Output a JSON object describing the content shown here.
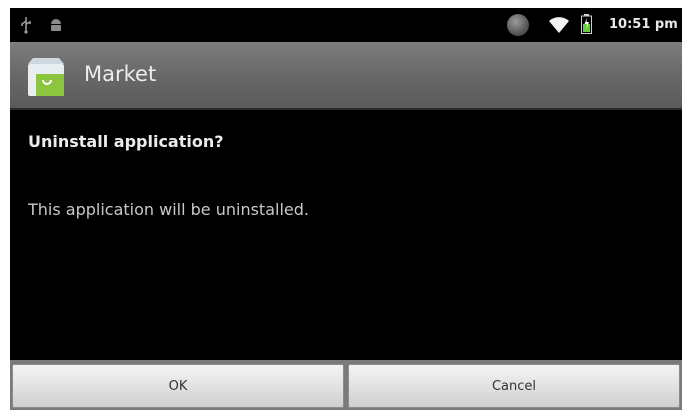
{
  "status_bar": {
    "time": "10:51 pm",
    "icons": [
      "usb-icon",
      "android-debug-icon",
      "globe-icon",
      "wifi-icon",
      "battery-icon"
    ]
  },
  "app_bar": {
    "title": "Market",
    "icon": "market-bag-icon"
  },
  "dialog": {
    "title": "Uninstall application?",
    "message": "This application will be uninstalled.",
    "ok_label": "OK",
    "cancel_label": "Cancel"
  },
  "colors": {
    "background": "#000000",
    "title_bar": "#6a6a6a",
    "button": "#e2e2e2",
    "market_green": "#8cc63f"
  }
}
